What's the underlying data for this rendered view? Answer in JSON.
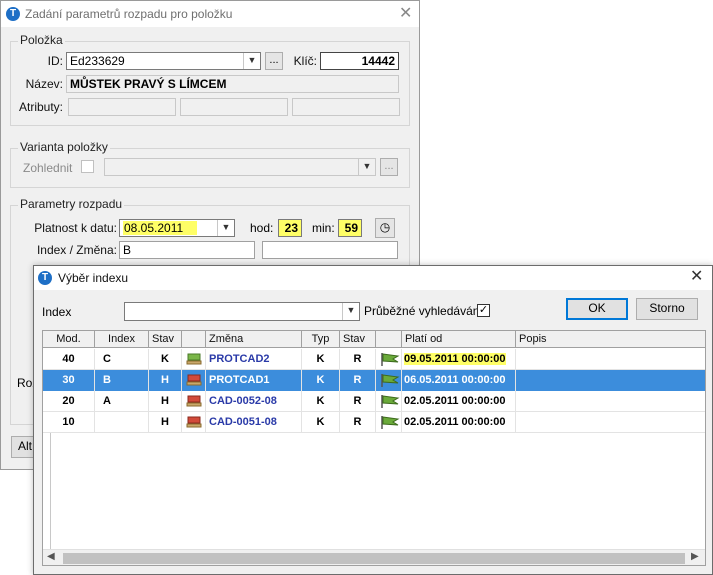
{
  "back_dialog": {
    "title": "Zadání parametrů rozpadu pro položku",
    "polozka": {
      "group_label": "Položka",
      "id_label": "ID:",
      "id_value": "Ed233629",
      "browse_label": "...",
      "klic_label": "Klíč:",
      "klic_value": "14442",
      "nazev_label": "Název:",
      "nazev_value": "MŮSTEK PRAVÝ S LÍMCEM",
      "atributy_label": "Atributy:"
    },
    "varianta": {
      "group_label": "Varianta položky",
      "zohlednit_label": "Zohlednit",
      "browse_label": "..."
    },
    "parametry": {
      "group_label": "Parametry rozpadu",
      "platnost_label": "Platnost k datu:",
      "platnost_value": "08.05.2011",
      "hod_label": "hod:",
      "hod_value": "23",
      "min_label": "min:",
      "min_value": "59",
      "index_label": "Index / Změna:",
      "index_value": "B"
    },
    "partial_labels": {
      "roz": "Roz",
      "alt": "Alt"
    }
  },
  "front_dialog": {
    "title": "Výběr indexu",
    "index_label": "Index",
    "index_value": "",
    "live_search_label": "Průběžné vyhledávání",
    "live_search_checked": true,
    "ok_label": "OK",
    "cancel_label": "Storno",
    "columns": [
      "Mod.",
      "Index",
      "Stav",
      "",
      "Změna",
      "Typ",
      "Stav",
      "",
      "Platí od",
      "Popis"
    ],
    "rows": [
      {
        "mod": "40",
        "index": "C",
        "stav": "K",
        "zmena": "PROTCAD2",
        "typ": "K",
        "stav2": "R",
        "plati_od": "09.05.2011 00:00:00",
        "popis": "",
        "selected": false,
        "highlight": true
      },
      {
        "mod": "30",
        "index": "B",
        "stav": "H",
        "zmena": "PROTCAD1",
        "typ": "K",
        "stav2": "R",
        "plati_od": "06.05.2011 00:00:00",
        "popis": "",
        "selected": true,
        "highlight": false
      },
      {
        "mod": "20",
        "index": "A",
        "stav": "H",
        "zmena": "CAD-0052-08",
        "typ": "K",
        "stav2": "R",
        "plati_od": "02.05.2011 00:00:00",
        "popis": "",
        "selected": false,
        "highlight": false
      },
      {
        "mod": "10",
        "index": "",
        "stav": "H",
        "zmena": "CAD-0051-08",
        "typ": "K",
        "stav2": "R",
        "plati_od": "02.05.2011 00:00:00",
        "popis": "",
        "selected": false,
        "highlight": false
      }
    ]
  },
  "colors": {
    "selection": "#3c8ddc",
    "highlight": "#ffff66",
    "link": "#2a3aa8",
    "accent": "#0078d7"
  }
}
